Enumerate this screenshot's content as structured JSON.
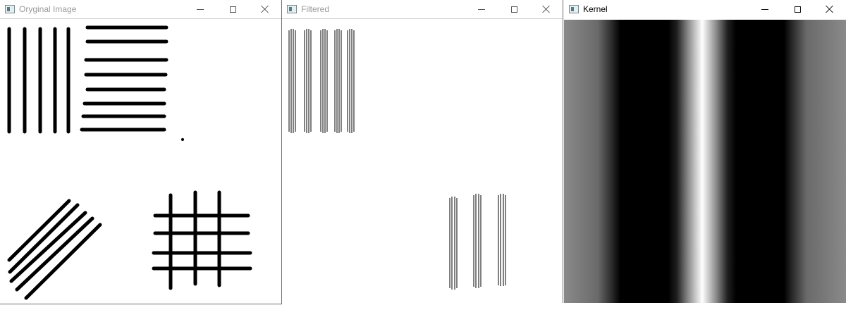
{
  "windows": {
    "original": {
      "title": "Oryginal Image",
      "icon": "opencv-window-icon"
    },
    "filtered": {
      "title": "Filtered",
      "icon": "opencv-window-icon"
    },
    "kernel": {
      "title": "Kernel",
      "icon": "opencv-window-icon"
    }
  },
  "controls": {
    "minimize": "minimize-icon",
    "maximize": "maximize-icon",
    "close": "close-icon"
  },
  "colors": {
    "titlebar": "#ffffff",
    "inactive_title_text": "#9a9a9a",
    "active_title_text": "#000000",
    "stroke": "#000000",
    "window_border": "#6e6e6e"
  }
}
